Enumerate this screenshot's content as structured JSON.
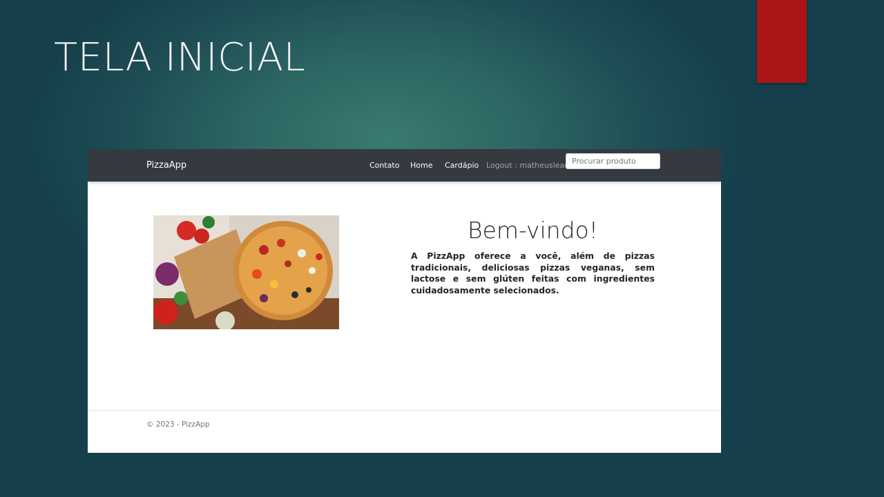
{
  "slide": {
    "title": "TELA INICIAL"
  },
  "navbar": {
    "brand": "PizzaApp",
    "links": [
      "Contato",
      "Home",
      "Cardápio"
    ],
    "logout": "Logout : matheusleao",
    "search_placeholder": "Procurar produto"
  },
  "main": {
    "heading": "Bem-vindo!",
    "description": "A PizzApp oferece a você, além de pizzas tradicionais, deliciosas pizzas veganas, sem lactose e sem glúten feitas com ingredientes cuidadosamente selecionados."
  },
  "footer": {
    "text": "© 2023 - PizzApp"
  },
  "colors": {
    "navbar": "#343a40",
    "accent_tab": "#ab1516"
  }
}
